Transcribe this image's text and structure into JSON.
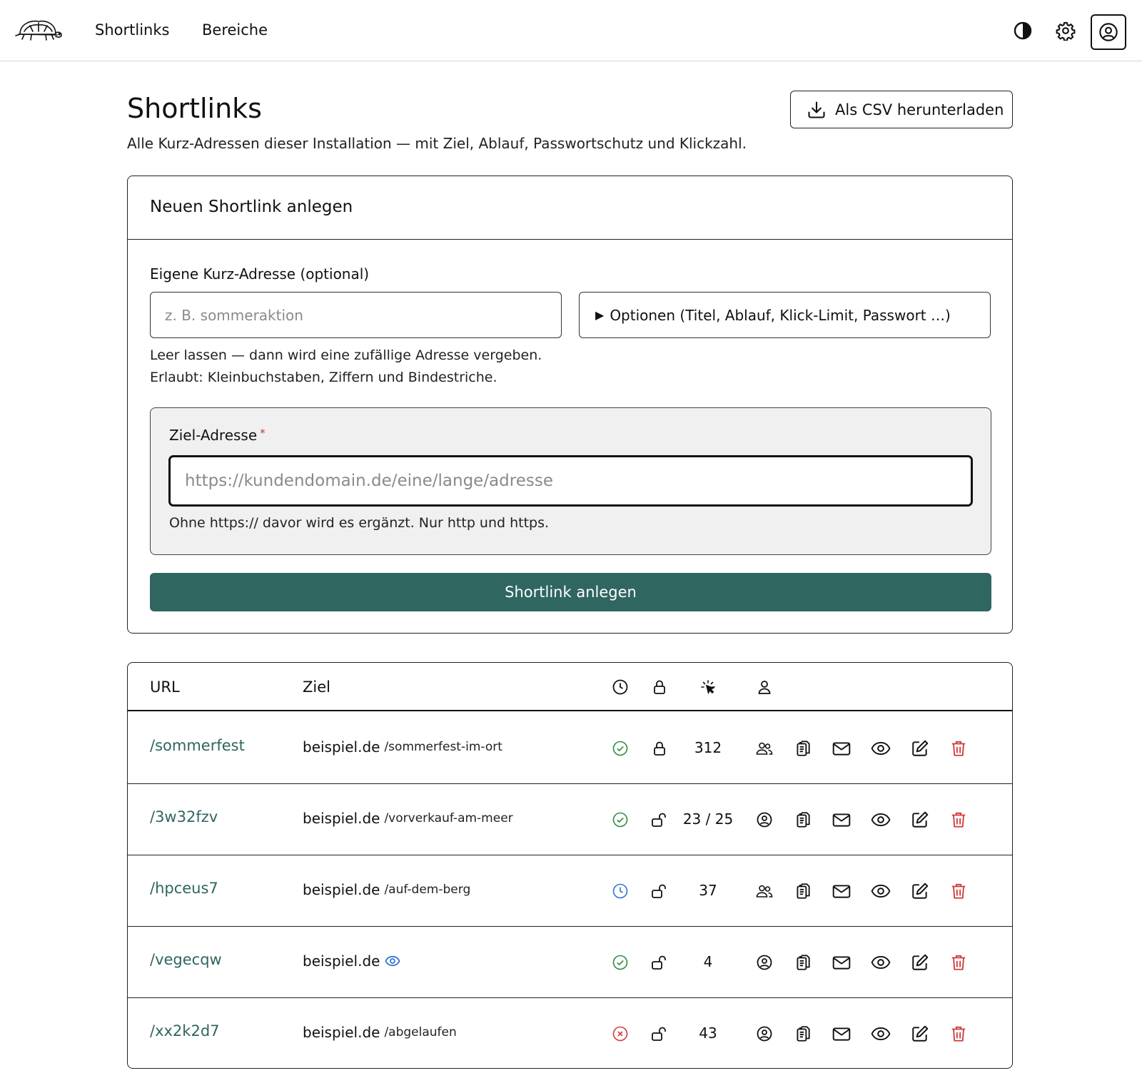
{
  "nav": {
    "items": [
      {
        "label": "Shortlinks"
      },
      {
        "label": "Bereiche"
      }
    ]
  },
  "header": {
    "title": "Shortlinks",
    "subtitle": "Alle Kurz-Adressen dieser Installation — mit Ziel, Ablauf, Passwortschutz und Klickzahl.",
    "csv_button": "Als CSV herunterladen"
  },
  "create": {
    "title": "Neuen Shortlink anlegen",
    "slug_label": "Eigene Kurz-Adresse (optional)",
    "slug_placeholder": "z. B. sommeraktion",
    "slug_value": "",
    "options_label": "Optionen (Titel, Ablauf, Klick-Limit, Passwort …)",
    "help_1": "Leer lassen — dann wird eine zufällige Adresse vergeben.",
    "help_2": "Erlaubt: Kleinbuchstaben, Ziffern und Bindestriche.",
    "target_label": "Ziel-Adresse",
    "target_required": "*",
    "target_placeholder": "https://kundendomain.de/eine/lange/adresse",
    "target_value": "",
    "target_help": "Ohne https:// davor wird es ergänzt. Nur http und https.",
    "submit_label": "Shortlink anlegen"
  },
  "table": {
    "headers": {
      "url": "URL",
      "ziel": "Ziel"
    },
    "header_icons": [
      "clock-icon",
      "lock-icon",
      "click-icon",
      "user-icon"
    ],
    "rows": [
      {
        "url": "/sommerfest",
        "domain": "beispiel.de",
        "path": "/sommerfest-im-ort",
        "status": "active",
        "locked": true,
        "clicks": "312",
        "audience": "group"
      },
      {
        "url": "/3w32fzv",
        "domain": "beispiel.de",
        "path": "/vorverkauf-am-meer",
        "status": "active",
        "locked": false,
        "clicks": "23 / 25",
        "audience": "single"
      },
      {
        "url": "/hpceus7",
        "domain": "beispiel.de",
        "path": "/auf-dem-berg",
        "status": "scheduled",
        "locked": false,
        "clicks": "37",
        "audience": "group"
      },
      {
        "url": "/vegecqw",
        "domain": "beispiel.de",
        "path": "",
        "preview_icon": true,
        "status": "active",
        "locked": false,
        "clicks": "4",
        "audience": "single"
      },
      {
        "url": "/xx2k2d7",
        "domain": "beispiel.de",
        "path": "/abgelaufen",
        "status": "expired",
        "locked": false,
        "clicks": "43",
        "audience": "single"
      }
    ],
    "row_actions": [
      "copy-icon",
      "mail-icon",
      "eye-icon",
      "edit-icon",
      "trash-icon"
    ]
  },
  "colors": {
    "accent": "#2f6660",
    "status_active": "#2e8b3e",
    "status_scheduled": "#2f6fd6",
    "status_expired": "#d03a3a",
    "delete": "#d03a3a",
    "preview": "#2f6fd6"
  }
}
